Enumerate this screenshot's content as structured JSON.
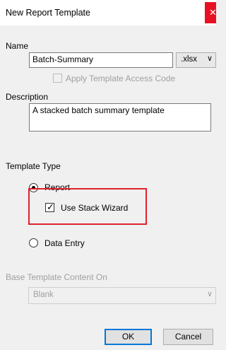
{
  "window": {
    "title": "New Report Template",
    "close_icon": "close-icon"
  },
  "name_section": {
    "label": "Name",
    "value": "Batch-Summary",
    "format_value": ".xlsx",
    "access_code_label": "Apply Template Access Code",
    "access_code_checked": false
  },
  "description_section": {
    "label": "Description",
    "value": "A stacked batch summary template"
  },
  "template_type": {
    "label": "Template Type",
    "report_label": "Report",
    "report_selected": true,
    "stack_wizard_label": "Use Stack Wizard",
    "stack_wizard_checked": true,
    "data_entry_label": "Data Entry",
    "data_entry_selected": false
  },
  "base_template": {
    "label": "Base Template Content On",
    "value": "Blank"
  },
  "buttons": {
    "ok": "OK",
    "cancel": "Cancel"
  },
  "colors": {
    "highlight": "#e0202e",
    "close": "#e81123",
    "focus": "#0078d7"
  }
}
